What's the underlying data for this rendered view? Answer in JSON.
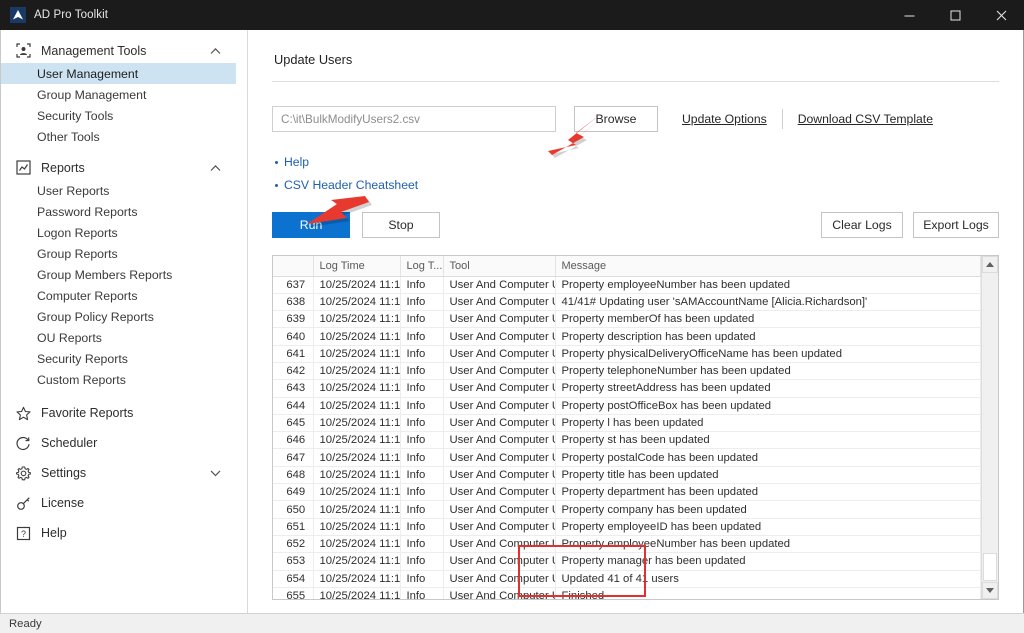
{
  "window": {
    "title": "AD Pro Toolkit",
    "logo_icon": "triangle-logo-icon",
    "minimize_label": "Minimize",
    "maximize_label": "Maximize",
    "close_label": "Close"
  },
  "sidebar": {
    "groups": [
      {
        "label": "Management Tools",
        "icon": "user-frame-icon",
        "chevron": "chevron-up-icon",
        "items": [
          {
            "label": "User Management",
            "selected": true
          },
          {
            "label": "Group Management",
            "selected": false
          },
          {
            "label": "Security Tools",
            "selected": false
          },
          {
            "label": "Other Tools",
            "selected": false
          }
        ]
      },
      {
        "label": "Reports",
        "icon": "chart-box-icon",
        "chevron": "chevron-up-icon",
        "items": [
          {
            "label": "User Reports",
            "selected": false
          },
          {
            "label": "Password Reports",
            "selected": false
          },
          {
            "label": "Logon Reports",
            "selected": false
          },
          {
            "label": "Group Reports",
            "selected": false
          },
          {
            "label": "Group Members Reports",
            "selected": false
          },
          {
            "label": "Computer Reports",
            "selected": false
          },
          {
            "label": "Group Policy Reports",
            "selected": false
          },
          {
            "label": "OU Reports",
            "selected": false
          },
          {
            "label": "Security Reports",
            "selected": false
          },
          {
            "label": "Custom Reports",
            "selected": false
          }
        ]
      }
    ],
    "leaves": [
      {
        "label": "Favorite Reports",
        "icon": "star-icon",
        "chevron": ""
      },
      {
        "label": "Scheduler",
        "icon": "clock-refresh-icon",
        "chevron": ""
      },
      {
        "label": "Settings",
        "icon": "gear-icon",
        "chevron": "chevron-down-icon"
      },
      {
        "label": "License",
        "icon": "key-icon",
        "chevron": ""
      },
      {
        "label": "Help",
        "icon": "question-box-icon",
        "chevron": ""
      }
    ]
  },
  "main": {
    "panel_title": "Update Users",
    "file_path": "C:\\it\\BulkModifyUsers2.csv",
    "browse_label": "Browse",
    "update_options_label": "Update Options",
    "download_template_label": "Download CSV Template",
    "bullets": [
      {
        "label": "Help"
      },
      {
        "label": "CSV Header Cheatsheet"
      }
    ],
    "run_label": "Run",
    "stop_label": "Stop",
    "clear_logs_label": "Clear Logs",
    "export_logs_label": "Export Logs"
  },
  "log_table": {
    "headers": [
      "",
      "Log Time",
      "Log T...",
      "Tool",
      "Message"
    ],
    "rows": [
      [
        "637",
        "10/25/2024 11:1...",
        "Info",
        "User And Computer U...",
        "Property employeeNumber has been updated"
      ],
      [
        "638",
        "10/25/2024 11:1...",
        "Info",
        "User And Computer U...",
        "41/41# Updating user 'sAMAccountName [Alicia.Richardson]'"
      ],
      [
        "639",
        "10/25/2024 11:1...",
        "Info",
        "User And Computer U...",
        "Property memberOf has been updated"
      ],
      [
        "640",
        "10/25/2024 11:1...",
        "Info",
        "User And Computer U...",
        "Property description has been updated"
      ],
      [
        "641",
        "10/25/2024 11:1...",
        "Info",
        "User And Computer U...",
        "Property physicalDeliveryOfficeName has been updated"
      ],
      [
        "642",
        "10/25/2024 11:1...",
        "Info",
        "User And Computer U...",
        "Property telephoneNumber has been updated"
      ],
      [
        "643",
        "10/25/2024 11:1...",
        "Info",
        "User And Computer U...",
        "Property streetAddress has been updated"
      ],
      [
        "644",
        "10/25/2024 11:1...",
        "Info",
        "User And Computer U...",
        "Property postOfficeBox has been updated"
      ],
      [
        "645",
        "10/25/2024 11:1...",
        "Info",
        "User And Computer U...",
        "Property l has been updated"
      ],
      [
        "646",
        "10/25/2024 11:1...",
        "Info",
        "User And Computer U...",
        "Property st has been updated"
      ],
      [
        "647",
        "10/25/2024 11:1...",
        "Info",
        "User And Computer U...",
        "Property postalCode has been updated"
      ],
      [
        "648",
        "10/25/2024 11:1...",
        "Info",
        "User And Computer U...",
        "Property title has been updated"
      ],
      [
        "649",
        "10/25/2024 11:1...",
        "Info",
        "User And Computer U...",
        "Property department has been updated"
      ],
      [
        "650",
        "10/25/2024 11:1...",
        "Info",
        "User And Computer U...",
        "Property company has been updated"
      ],
      [
        "651",
        "10/25/2024 11:1...",
        "Info",
        "User And Computer U...",
        "Property employeeID has been updated"
      ],
      [
        "652",
        "10/25/2024 11:1...",
        "Info",
        "User And Computer U...",
        "Property employeeNumber has been updated"
      ],
      [
        "653",
        "10/25/2024 11:1...",
        "Info",
        "User And Computer U...",
        "Property manager has been updated"
      ],
      [
        "654",
        "10/25/2024 11:1...",
        "Info",
        "User And Computer U...",
        "Updated 41 of 41 users"
      ],
      [
        "655",
        "10/25/2024 11:1...",
        "Info",
        "User And Computer U...",
        "Finished"
      ]
    ]
  },
  "annotations": {
    "arrow_browse": "red-arrow-pointing-at-browse",
    "arrow_run": "red-arrow-pointing-at-run",
    "highlight_box": "red-rectangle-around-completion-messages",
    "color": "#e03131"
  },
  "statusbar": {
    "text": "Ready"
  }
}
